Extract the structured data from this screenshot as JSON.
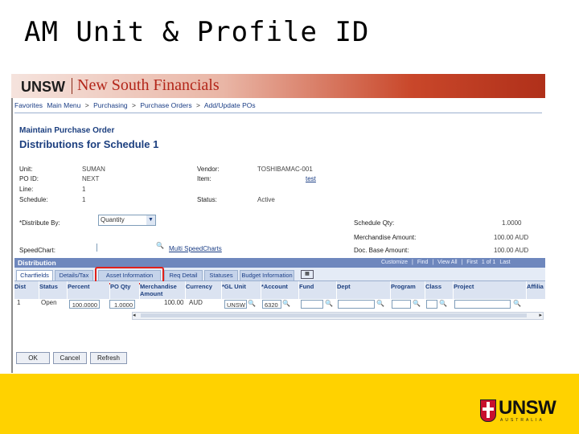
{
  "slide": {
    "title": "AM Unit & Profile ID"
  },
  "banner": {
    "logo": "UNSW",
    "name": "New South Financials"
  },
  "breadcrumbs": [
    "Favorites",
    "Main Menu",
    ">",
    "Purchasing",
    ">",
    "Purchase Orders",
    ">",
    "Add/Update POs"
  ],
  "page": {
    "subtitle": "Maintain Purchase Order",
    "heading": "Distributions for Schedule 1"
  },
  "fields": {
    "unit_label": "Unit:",
    "unit_value": "SUMAN",
    "po_label": "PO ID:",
    "po_value": "NEXT",
    "line_label": "Line:",
    "line_value": "1",
    "schedule_label": "Schedule:",
    "schedule_value": "1",
    "vendor_label": "Vendor:",
    "vendor_value": "TOSHIBAMAC-001",
    "item_label": "Item:",
    "item_value": "test",
    "status_label": "Status:",
    "status_value": "Active",
    "distribute_label": "*Distribute By:",
    "distribute_value": "Quantity",
    "speedchart_label": "SpeedChart:",
    "speedchart_link": "Multi SpeedCharts",
    "schedqty_label": "Schedule Qty:",
    "schedqty_value": "1.0000",
    "merch_label": "Merchandise Amount:",
    "merch_value": "100.00 AUD",
    "docbase_label": "Doc. Base Amount:",
    "docbase_value": "100.00 AUD"
  },
  "grid": {
    "title": "Distribution",
    "nav": [
      "Customize",
      "|",
      "Find",
      "|",
      "View All",
      "|",
      "First",
      "1 of 1",
      "Last"
    ],
    "tabs": [
      "Chartfields",
      "Details/Tax",
      "Asset Information",
      "Req Detail",
      "Statuses",
      "Budget Information"
    ],
    "columns": [
      "Dist",
      "Status",
      "Percent",
      "PO Qty",
      "Merchandise Amount",
      "Currency",
      "*GL Unit",
      "*Account",
      "Fund",
      "Dept",
      "Program",
      "Class",
      "Project",
      "Affilia"
    ],
    "row": {
      "dist": "1",
      "status": "Open",
      "percent": "100.0000",
      "po_qty": "1.0000",
      "amount": "100.00",
      "currency": "AUD",
      "gl_unit": "UNSW",
      "account": "6320",
      "fund": "",
      "dept": "",
      "program": "",
      "class": "",
      "project": ""
    }
  },
  "buttons": {
    "ok": "OK",
    "cancel": "Cancel",
    "refresh": "Refresh"
  },
  "footer": {
    "logo": "UNSW",
    "sub": "AUSTRALIA"
  },
  "colors": {
    "accent": "#1c3f7f",
    "highlight": "#e0201a",
    "footer": "#ffd200"
  }
}
